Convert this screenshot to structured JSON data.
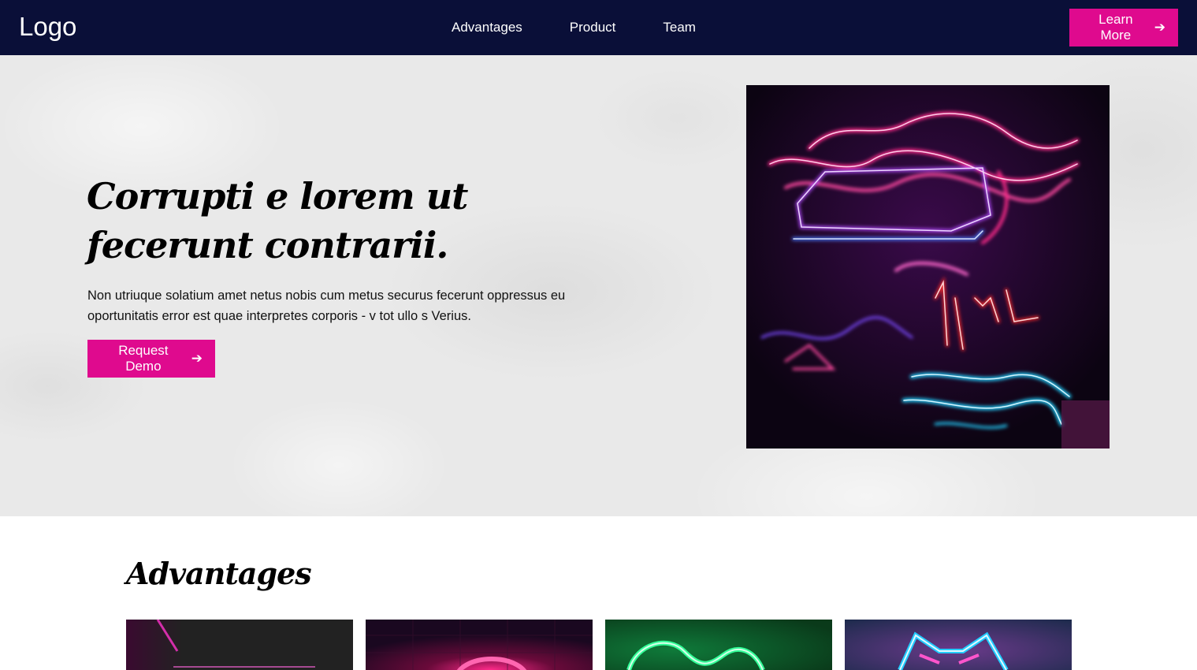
{
  "nav": {
    "logo": "Logo",
    "links": [
      "Advantages",
      "Product",
      "Team"
    ],
    "cta_label": "Learn More",
    "cta_arrow": "➔"
  },
  "hero": {
    "title": "Corrupti e lorem ut fecerunt contrarii.",
    "text": "Non utriuque solatium amet netus nobis cum metus securus fecerunt oppressus eu oportunitatis error est quae interpretes corporis - v tot ullo s Verius.",
    "button_label": "Request Demo",
    "button_arrow": "➔",
    "image_icon": "neon-sign-image"
  },
  "advantages": {
    "title": "Advantages",
    "cards": [
      {
        "image_icon": "neon-magenta-image"
      },
      {
        "image_icon": "neon-pink-circle-image"
      },
      {
        "image_icon": "neon-green-image"
      },
      {
        "image_icon": "neon-blue-image"
      }
    ]
  },
  "colors": {
    "nav_bg": "#0a0f38",
    "accent": "#df0a8e",
    "hero_bg": "#e9e9e9"
  }
}
